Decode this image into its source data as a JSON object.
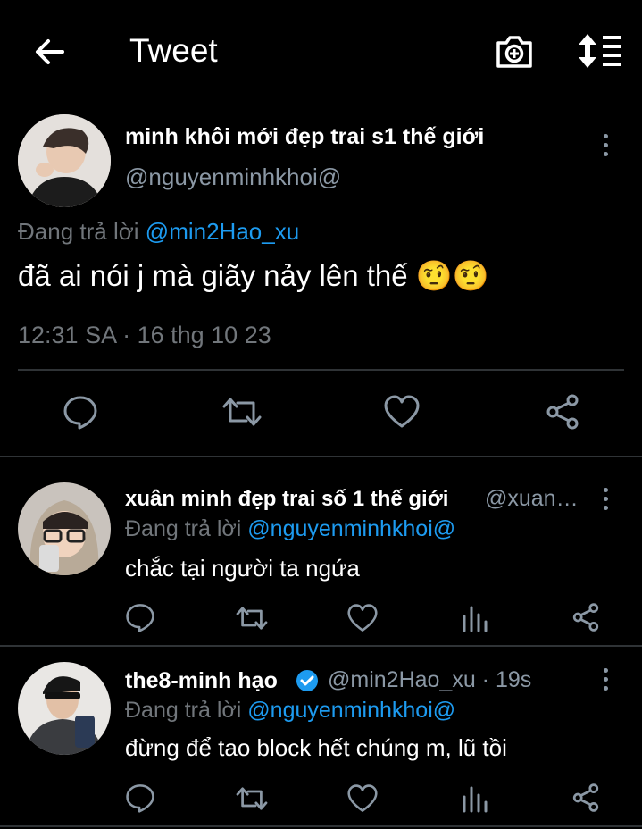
{
  "header": {
    "title": "Tweet",
    "back_icon": "arrow-left-icon",
    "camera_icon": "camera-add-icon",
    "sort_icon": "sort-icon"
  },
  "main_tweet": {
    "display_name": "minh khôi mới đẹp trai s1 thế giới",
    "handle": "@nguyenminhkhoi@",
    "reply_prefix": "Đang trả lời",
    "reply_to": "@min2Hao_xu",
    "text": "đã ai nói j mà giãy nảy lên thế",
    "emojis": "🤨🤨",
    "timestamp": "12:31 SA · 16 thg 10 23"
  },
  "replies": [
    {
      "display_name": "xuân minh đẹp trai số 1 thế giới",
      "handle": "@xuan…",
      "reply_prefix": "Đang trả lời",
      "reply_to": "@nguyenminhkhoi@",
      "text": "chắc tại người ta ngứa"
    },
    {
      "display_name": "the8-minh hạo",
      "handle": "@min2Hao_xu · 19s",
      "reply_prefix": "Đang trả lời",
      "reply_to": "@nguyenminhkhoi@",
      "text": "đừng để tao block hết chúng m, lũ tồi"
    }
  ],
  "colors": {
    "background": "#000000",
    "link": "#1d9bf0",
    "muted": "#71767b",
    "verified": "#1d9bf0"
  }
}
